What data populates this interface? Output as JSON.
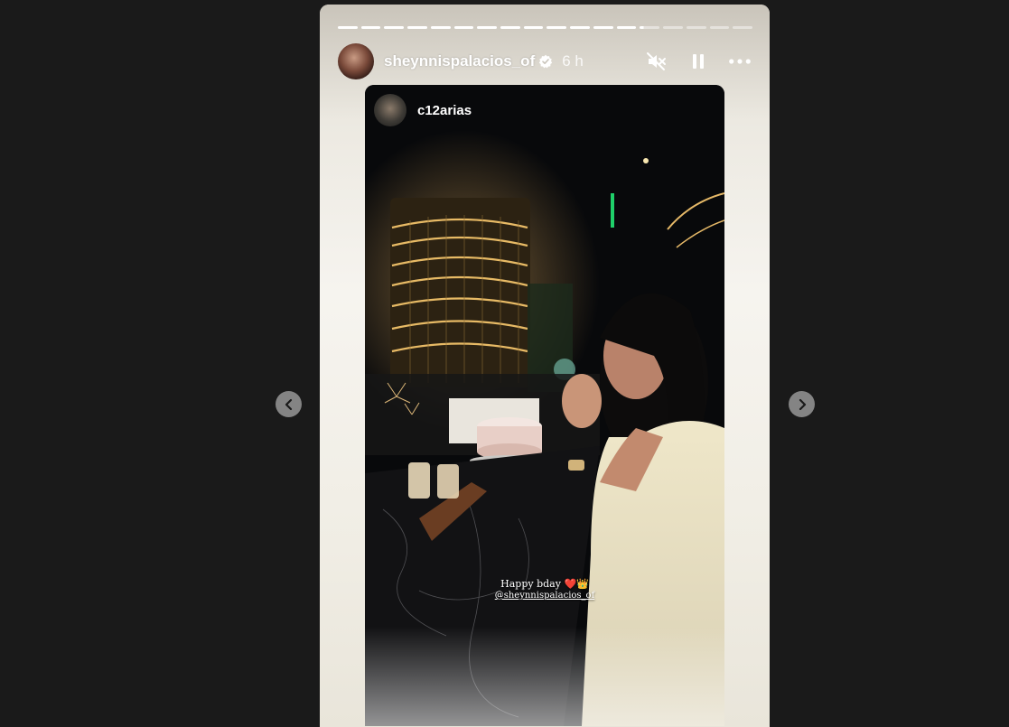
{
  "story": {
    "progress": {
      "total_segments": 18,
      "completed_segments": 13,
      "current_fraction": 0.2
    },
    "author": {
      "username": "sheynnispalacios_of",
      "verified": true,
      "time": "6 h"
    },
    "controls": {
      "mute_icon": "volume-muted-icon",
      "pause_icon": "pause-icon",
      "more_icon": "more-options-icon"
    },
    "repost": {
      "username": "c12arias"
    },
    "caption": {
      "line1": "Happy bday ❤️👑",
      "line2": "@sheynnispalacios_of"
    }
  },
  "navigation": {
    "prev_icon": "chevron-left-icon",
    "next_icon": "chevron-right-icon"
  },
  "colors": {
    "page_bg": "#1a1a1a",
    "verified_blue": "#ffffff",
    "accent_white": "#ffffff"
  }
}
